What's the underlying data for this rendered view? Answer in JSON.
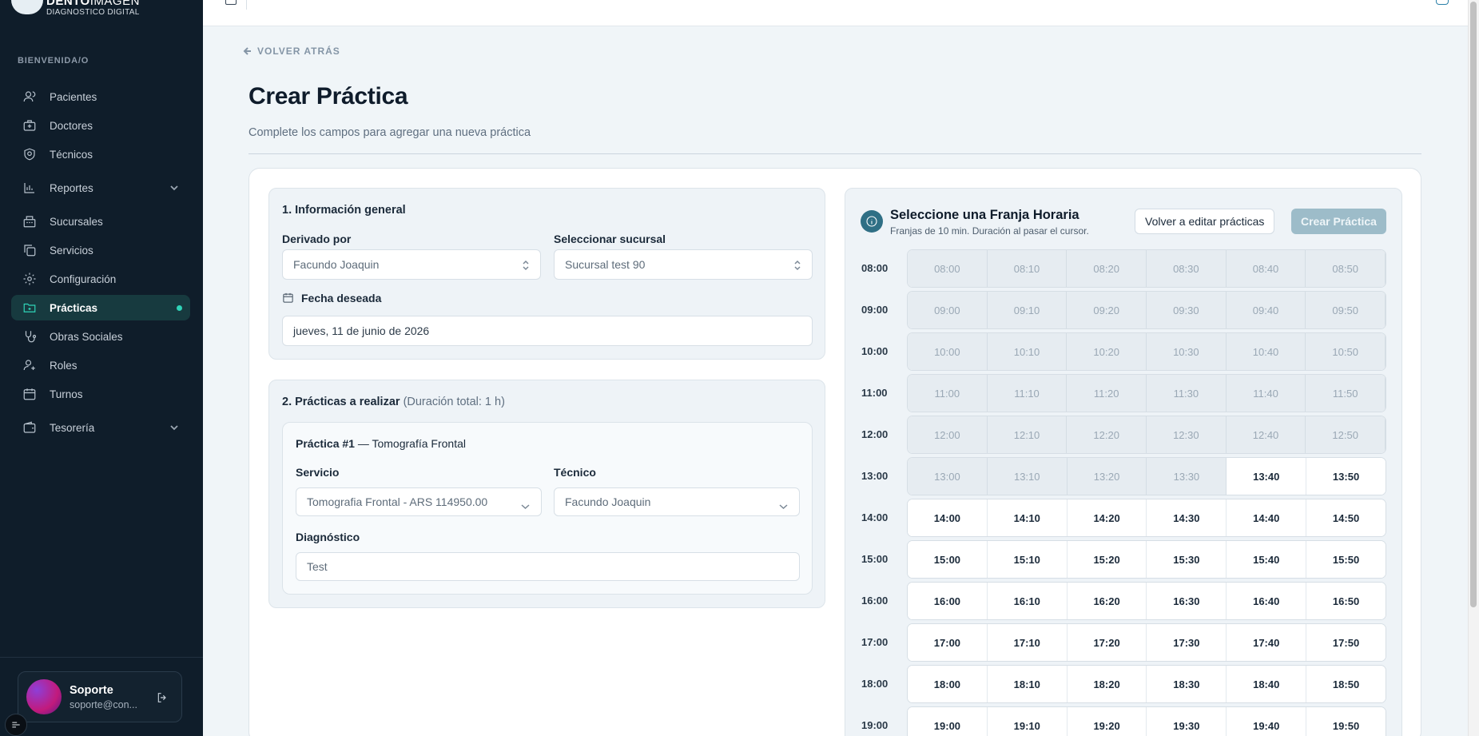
{
  "brand": {
    "name_bold": "DENTO",
    "name_light": "IMAGEN",
    "subtitle": "DIAGNOSTICO DIGITAL"
  },
  "sidebar": {
    "section_label": "BIENVENIDA/O",
    "items": [
      {
        "label": "Pacientes",
        "icon": "users-icon"
      },
      {
        "label": "Doctores",
        "icon": "medical-bag-icon"
      },
      {
        "label": "Técnicos",
        "icon": "shield-icon"
      },
      {
        "label": "Reportes",
        "icon": "bar-chart-icon",
        "expandable": true
      },
      {
        "label": "Sucursales",
        "icon": "building-icon"
      },
      {
        "label": "Servicios",
        "icon": "copy-icon"
      },
      {
        "label": "Configuración",
        "icon": "gear-icon"
      },
      {
        "label": "Prácticas",
        "icon": "folder-icon",
        "active": true
      },
      {
        "label": "Obras Sociales",
        "icon": "stethoscope-icon"
      },
      {
        "label": "Roles",
        "icon": "user-plus-icon"
      },
      {
        "label": "Turnos",
        "icon": "calendar-icon"
      },
      {
        "label": "Tesorería",
        "icon": "wallet-icon",
        "expandable": true
      }
    ],
    "user": {
      "name": "Soporte",
      "email": "soporte@con..."
    }
  },
  "main": {
    "back_label": "VOLVER ATRÁS",
    "title": "Crear Práctica",
    "subtitle": "Complete los campos para agregar una nueva práctica"
  },
  "general": {
    "title": "1. Información general",
    "derivado_label": "Derivado por",
    "derivado_value": "Facundo Joaquin",
    "sucursal_label": "Seleccionar sucursal",
    "sucursal_value": "Sucursal test 90",
    "fecha_label": "Fecha deseada",
    "fecha_value": "jueves, 11 de junio de 2026"
  },
  "practicas": {
    "title": "2. Prácticas a realizar",
    "duration": "(Duración total: 1 h)",
    "item_title": "Práctica #1",
    "item_name": "— Tomografía Frontal",
    "servicio_label": "Servicio",
    "servicio_value": "Tomografia Frontal - ARS 114950.00",
    "tecnico_label": "Técnico",
    "tecnico_value": "Facundo Joaquin",
    "diagnostico_label": "Diagnóstico",
    "diagnostico_value": "Test"
  },
  "schedule": {
    "title": "Seleccione una Franja Horaria",
    "subtitle": "Franjas de 10 min. Duración al pasar el cursor.",
    "edit_button": "Volver a editar prácticas",
    "create_button": "Crear Práctica",
    "rows": [
      {
        "hour": "08:00",
        "slots": [
          {
            "t": "08:00",
            "d": true
          },
          {
            "t": "08:10",
            "d": true
          },
          {
            "t": "08:20",
            "d": true
          },
          {
            "t": "08:30",
            "d": true
          },
          {
            "t": "08:40",
            "d": true
          },
          {
            "t": "08:50",
            "d": true
          }
        ]
      },
      {
        "hour": "09:00",
        "slots": [
          {
            "t": "09:00",
            "d": true
          },
          {
            "t": "09:10",
            "d": true
          },
          {
            "t": "09:20",
            "d": true
          },
          {
            "t": "09:30",
            "d": true
          },
          {
            "t": "09:40",
            "d": true
          },
          {
            "t": "09:50",
            "d": true
          }
        ]
      },
      {
        "hour": "10:00",
        "slots": [
          {
            "t": "10:00",
            "d": true
          },
          {
            "t": "10:10",
            "d": true
          },
          {
            "t": "10:20",
            "d": true
          },
          {
            "t": "10:30",
            "d": true
          },
          {
            "t": "10:40",
            "d": true
          },
          {
            "t": "10:50",
            "d": true
          }
        ]
      },
      {
        "hour": "11:00",
        "slots": [
          {
            "t": "11:00",
            "d": true
          },
          {
            "t": "11:10",
            "d": true
          },
          {
            "t": "11:20",
            "d": true
          },
          {
            "t": "11:30",
            "d": true
          },
          {
            "t": "11:40",
            "d": true
          },
          {
            "t": "11:50",
            "d": true
          }
        ]
      },
      {
        "hour": "12:00",
        "slots": [
          {
            "t": "12:00",
            "d": true
          },
          {
            "t": "12:10",
            "d": true
          },
          {
            "t": "12:20",
            "d": true
          },
          {
            "t": "12:30",
            "d": true
          },
          {
            "t": "12:40",
            "d": true
          },
          {
            "t": "12:50",
            "d": true
          }
        ]
      },
      {
        "hour": "13:00",
        "slots": [
          {
            "t": "13:00",
            "d": true
          },
          {
            "t": "13:10",
            "d": true
          },
          {
            "t": "13:20",
            "d": true
          },
          {
            "t": "13:30",
            "d": true
          },
          {
            "t": "13:40",
            "d": false
          },
          {
            "t": "13:50",
            "d": false
          }
        ]
      },
      {
        "hour": "14:00",
        "slots": [
          {
            "t": "14:00",
            "d": false
          },
          {
            "t": "14:10",
            "d": false
          },
          {
            "t": "14:20",
            "d": false
          },
          {
            "t": "14:30",
            "d": false
          },
          {
            "t": "14:40",
            "d": false
          },
          {
            "t": "14:50",
            "d": false
          }
        ]
      },
      {
        "hour": "15:00",
        "slots": [
          {
            "t": "15:00",
            "d": false
          },
          {
            "t": "15:10",
            "d": false
          },
          {
            "t": "15:20",
            "d": false
          },
          {
            "t": "15:30",
            "d": false
          },
          {
            "t": "15:40",
            "d": false
          },
          {
            "t": "15:50",
            "d": false
          }
        ]
      },
      {
        "hour": "16:00",
        "slots": [
          {
            "t": "16:00",
            "d": false
          },
          {
            "t": "16:10",
            "d": false
          },
          {
            "t": "16:20",
            "d": false
          },
          {
            "t": "16:30",
            "d": false
          },
          {
            "t": "16:40",
            "d": false
          },
          {
            "t": "16:50",
            "d": false
          }
        ]
      },
      {
        "hour": "17:00",
        "slots": [
          {
            "t": "17:00",
            "d": false
          },
          {
            "t": "17:10",
            "d": false
          },
          {
            "t": "17:20",
            "d": false
          },
          {
            "t": "17:30",
            "d": false
          },
          {
            "t": "17:40",
            "d": false
          },
          {
            "t": "17:50",
            "d": false
          }
        ]
      },
      {
        "hour": "18:00",
        "slots": [
          {
            "t": "18:00",
            "d": false
          },
          {
            "t": "18:10",
            "d": false
          },
          {
            "t": "18:20",
            "d": false
          },
          {
            "t": "18:30",
            "d": false
          },
          {
            "t": "18:40",
            "d": false
          },
          {
            "t": "18:50",
            "d": false
          }
        ]
      },
      {
        "hour": "19:00",
        "slots": [
          {
            "t": "19:00",
            "d": false
          },
          {
            "t": "19:10",
            "d": false
          },
          {
            "t": "19:20",
            "d": false
          },
          {
            "t": "19:30",
            "d": false
          },
          {
            "t": "19:40",
            "d": false
          },
          {
            "t": "19:50",
            "d": false
          }
        ]
      }
    ]
  },
  "colors": {
    "sidebar_bg": "#0f1d2a",
    "accent": "#2fd3b7",
    "primary_disabled": "#9dbcc9",
    "info": "#2f6f85"
  }
}
